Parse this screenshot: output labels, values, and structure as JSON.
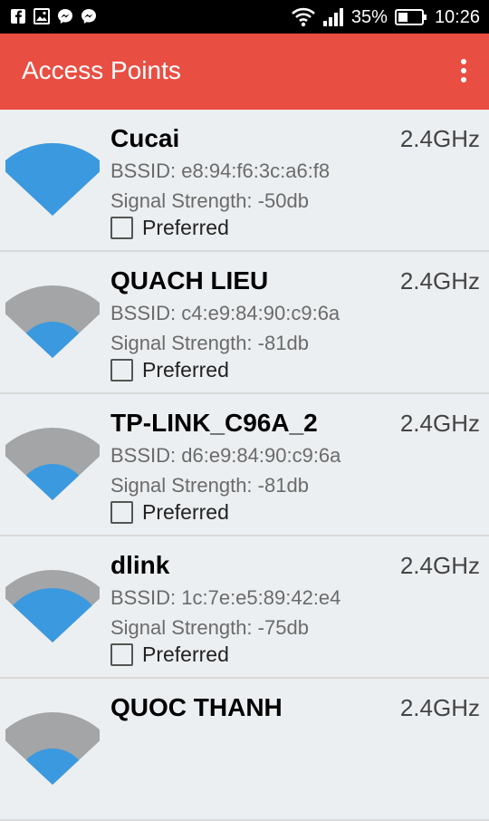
{
  "status_bar": {
    "icons_left": [
      "facebook-icon",
      "gallery-icon",
      "messenger-icon",
      "messenger-icon"
    ],
    "battery": "35%",
    "time": "10:26"
  },
  "app_bar": {
    "title": "Access Points",
    "menu_icon": "overflow-menu-icon"
  },
  "colors": {
    "app_bar": "#e94e43",
    "signal_active": "#3b99e0",
    "signal_inactive": "#a3a5a6"
  },
  "access_points": [
    {
      "ssid": "Cucai",
      "band": "2.4GHz",
      "bssid": "BSSID: e8:94:f6:3c:a6:f8",
      "signal": "Signal Strength: -50db",
      "preferred_label": "Preferred",
      "preferred": false,
      "signal_level": 4
    },
    {
      "ssid": "QUACH LIEU",
      "band": "2.4GHz",
      "bssid": "BSSID: c4:e9:84:90:c9:6a",
      "signal": "Signal Strength: -81db",
      "preferred_label": "Preferred",
      "preferred": false,
      "signal_level": 2
    },
    {
      "ssid": "TP-LINK_C96A_2",
      "band": "2.4GHz",
      "bssid": "BSSID: d6:e9:84:90:c9:6a",
      "signal": "Signal Strength: -81db",
      "preferred_label": "Preferred",
      "preferred": false,
      "signal_level": 2
    },
    {
      "ssid": "dlink",
      "band": "2.4GHz",
      "bssid": "BSSID: 1c:7e:e5:89:42:e4",
      "signal": "Signal Strength: -75db",
      "preferred_label": "Preferred",
      "preferred": false,
      "signal_level": 3
    },
    {
      "ssid": "QUOC THANH",
      "band": "2.4GHz",
      "bssid": "",
      "signal": "",
      "preferred_label": "",
      "preferred": false,
      "signal_level": 2
    }
  ]
}
